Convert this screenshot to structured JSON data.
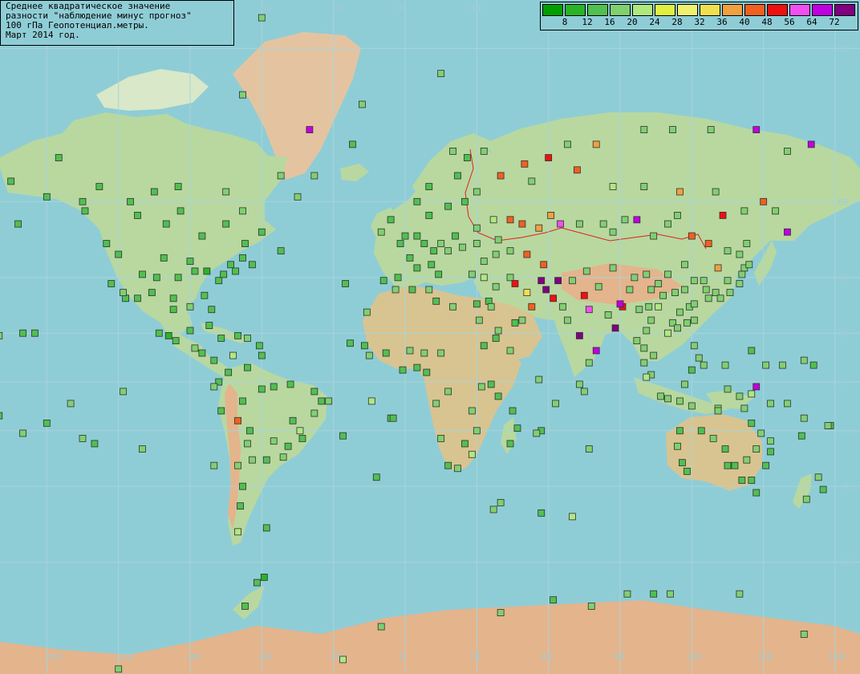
{
  "title_lines": [
    "Среднее квадратическое значение",
    "разности \"наблюдение минус прогноз\"",
    "100 гПа Геопотенциал.метры.",
    "Март 2014 год."
  ],
  "legend": {
    "thresholds": [
      "8",
      "12",
      "16",
      "20",
      "24",
      "28",
      "32",
      "36",
      "40",
      "48",
      "56",
      "64",
      "72"
    ],
    "colors": [
      "#00a000",
      "#28b428",
      "#50c050",
      "#80d070",
      "#b0e880",
      "#e0f040",
      "#f0f070",
      "#f0e050",
      "#f0a040",
      "#f06020",
      "#f01010",
      "#f050f0",
      "#c000e0",
      "#800080"
    ]
  },
  "grid": {
    "lon_labels": [
      "-150",
      "-120",
      "-90",
      "-60",
      "-30",
      "0",
      "30",
      "60",
      "90",
      "120",
      "150",
      "180"
    ],
    "lat_labels": [
      "80",
      "60",
      "40",
      "20",
      "0",
      "-20",
      "-40",
      "-60"
    ]
  },
  "colors": {
    "ocean": "#8fcdd6",
    "land": "#b8d8a0",
    "ice": "#eaf6f8",
    "highland": "#e4b48c",
    "border": "#e02020",
    "gridline": "#a8d4dc"
  },
  "stations": [
    [
      -175,
      70,
      3
    ],
    [
      -165,
      64,
      2
    ],
    [
      -162,
      55,
      2
    ],
    [
      -150,
      61,
      2
    ],
    [
      -145,
      68,
      2
    ],
    [
      -134,
      58,
      2
    ],
    [
      -125,
      50,
      2
    ],
    [
      -120,
      47,
      2
    ],
    [
      -123,
      38,
      2
    ],
    [
      -117,
      33,
      2
    ],
    [
      -118,
      35,
      3
    ],
    [
      -112,
      33,
      2
    ],
    [
      -106,
      35,
      2
    ],
    [
      -110,
      41,
      2
    ],
    [
      -104,
      40,
      2
    ],
    [
      -101,
      46,
      2
    ],
    [
      -97,
      33,
      2
    ],
    [
      -97,
      29,
      2
    ],
    [
      -95,
      40,
      2
    ],
    [
      -90,
      45,
      2
    ],
    [
      -90,
      30,
      3
    ],
    [
      -88,
      42,
      2
    ],
    [
      -84,
      34,
      2
    ],
    [
      -83,
      42,
      1
    ],
    [
      -81,
      29,
      2
    ],
    [
      -78,
      39,
      2
    ],
    [
      -76,
      41,
      2
    ],
    [
      -73,
      44,
      2
    ],
    [
      -71,
      42,
      2
    ],
    [
      -68,
      46,
      2
    ],
    [
      -64,
      44,
      2
    ],
    [
      -112,
      57,
      2
    ],
    [
      -100,
      55,
      2
    ],
    [
      -94,
      58,
      2
    ],
    [
      -85,
      52,
      2
    ],
    [
      -75,
      55,
      2
    ],
    [
      -67,
      50,
      2
    ],
    [
      -75,
      62,
      3
    ],
    [
      -68,
      58,
      3
    ],
    [
      -95,
      63,
      2
    ],
    [
      -105,
      62,
      2
    ],
    [
      -115,
      60,
      2
    ],
    [
      -128,
      63,
      2
    ],
    [
      -135,
      60,
      2
    ],
    [
      -60,
      53,
      2
    ],
    [
      -52,
      48,
      2
    ],
    [
      -52,
      65,
      3
    ],
    [
      -68,
      76,
      3
    ],
    [
      -45,
      61,
      3
    ],
    [
      -38,
      65,
      3
    ],
    [
      -22,
      70,
      2
    ],
    [
      -18,
      75,
      3
    ],
    [
      -40,
      72,
      12
    ],
    [
      -60,
      82,
      3
    ],
    [
      -103,
      20,
      2
    ],
    [
      -99,
      19,
      1
    ],
    [
      -96,
      17,
      2
    ],
    [
      -90,
      21,
      2
    ],
    [
      -88,
      14,
      3
    ],
    [
      -85,
      12,
      2
    ],
    [
      -80,
      9,
      2
    ],
    [
      -82,
      23,
      2
    ],
    [
      -77,
      18,
      2
    ],
    [
      -70,
      19,
      2
    ],
    [
      -66,
      18,
      3
    ],
    [
      -61,
      15,
      2
    ],
    [
      -60,
      11,
      2
    ],
    [
      -72,
      11,
      4
    ],
    [
      -66,
      6,
      2
    ],
    [
      -74,
      4,
      2
    ],
    [
      -78,
      0,
      2
    ],
    [
      -80,
      -2,
      3
    ],
    [
      -77,
      -12,
      2
    ],
    [
      -70,
      -16,
      9
    ],
    [
      -68,
      -8,
      2
    ],
    [
      -60,
      -3,
      2
    ],
    [
      -55,
      -2,
      2
    ],
    [
      -48,
      -1,
      2
    ],
    [
      -38,
      -4,
      2
    ],
    [
      -35,
      -8,
      2
    ],
    [
      -38,
      -13,
      3
    ],
    [
      -47,
      -16,
      2
    ],
    [
      -43,
      -23,
      2
    ],
    [
      -49,
      -26,
      2
    ],
    [
      -55,
      -24,
      3
    ],
    [
      -58,
      -31,
      2
    ],
    [
      -64,
      -31,
      3
    ],
    [
      -66,
      -25,
      3
    ],
    [
      -70,
      -33,
      3
    ],
    [
      -68,
      -40,
      2
    ],
    [
      -69,
      -46,
      2
    ],
    [
      -70,
      -53,
      4
    ],
    [
      -58,
      -52,
      2
    ],
    [
      -59,
      -63,
      1
    ],
    [
      -65,
      -20,
      2
    ],
    [
      -51,
      -30,
      3
    ],
    [
      -44,
      -20,
      4
    ],
    [
      -25,
      38,
      2
    ],
    [
      -16,
      28,
      3
    ],
    [
      -17,
      15,
      2
    ],
    [
      -23,
      16,
      2
    ],
    [
      -14,
      -8,
      4
    ],
    [
      -6,
      -15,
      2
    ],
    [
      -12,
      -37,
      2
    ],
    [
      -26,
      -22,
      2
    ],
    [
      -10,
      53,
      3
    ],
    [
      -2,
      50,
      2
    ],
    [
      -6,
      56,
      2
    ],
    [
      0,
      52,
      2
    ],
    [
      5,
      52,
      2
    ],
    [
      8,
      50,
      2
    ],
    [
      2,
      46,
      2
    ],
    [
      5,
      43,
      2
    ],
    [
      12,
      48,
      2
    ],
    [
      11,
      44,
      2
    ],
    [
      15,
      50,
      3
    ],
    [
      14,
      41,
      2
    ],
    [
      18,
      48,
      3
    ],
    [
      21,
      52,
      2
    ],
    [
      24,
      49,
      3
    ],
    [
      10,
      57,
      2
    ],
    [
      18,
      59,
      2
    ],
    [
      25,
      60,
      2
    ],
    [
      30,
      62,
      3
    ],
    [
      22,
      65,
      2
    ],
    [
      26,
      68,
      2
    ],
    [
      10,
      63,
      2
    ],
    [
      5,
      60,
      2
    ],
    [
      15,
      78,
      3
    ],
    [
      -3,
      40,
      2
    ],
    [
      -9,
      39,
      2
    ],
    [
      -4,
      36,
      3
    ],
    [
      3,
      36,
      2
    ],
    [
      10,
      36,
      3
    ],
    [
      13,
      32,
      2
    ],
    [
      20,
      30,
      3
    ],
    [
      30,
      31,
      2
    ],
    [
      31,
      25,
      3
    ],
    [
      33,
      15,
      2
    ],
    [
      38,
      18,
      2
    ],
    [
      32,
      -2,
      3
    ],
    [
      36,
      -1,
      2
    ],
    [
      39,
      -6,
      2
    ],
    [
      28,
      -12,
      3
    ],
    [
      30,
      -20,
      3
    ],
    [
      25,
      -25,
      2
    ],
    [
      28,
      -29,
      4
    ],
    [
      18,
      -33,
      2
    ],
    [
      22,
      -34,
      3
    ],
    [
      15,
      -23,
      3
    ],
    [
      13,
      -9,
      3
    ],
    [
      9,
      4,
      2
    ],
    [
      5,
      6,
      2
    ],
    [
      -1,
      5,
      2
    ],
    [
      -15,
      11,
      3
    ],
    [
      -8,
      12,
      2
    ],
    [
      2,
      13,
      3
    ],
    [
      8,
      12,
      3
    ],
    [
      15,
      12,
      3
    ],
    [
      18,
      -4,
      3
    ],
    [
      45,
      -12,
      2
    ],
    [
      47,
      -19,
      2
    ],
    [
      57,
      -20,
      2
    ],
    [
      55,
      -21,
      3
    ],
    [
      44,
      -25,
      2
    ],
    [
      28,
      41,
      3
    ],
    [
      33,
      40,
      4
    ],
    [
      38,
      37,
      3
    ],
    [
      44,
      40,
      3
    ],
    [
      35,
      32,
      2
    ],
    [
      36,
      30,
      3
    ],
    [
      39,
      21,
      3
    ],
    [
      46,
      24,
      2
    ],
    [
      44,
      13,
      3
    ],
    [
      49,
      25,
      3
    ],
    [
      53,
      30,
      9
    ],
    [
      51,
      35,
      7
    ],
    [
      59,
      36,
      13
    ],
    [
      46,
      38,
      10
    ],
    [
      57,
      39,
      13
    ],
    [
      62,
      33,
      10
    ],
    [
      66,
      30,
      3
    ],
    [
      68,
      25,
      3
    ],
    [
      73,
      19,
      13
    ],
    [
      77,
      29,
      11
    ],
    [
      80,
      13,
      12
    ],
    [
      77,
      8,
      3
    ],
    [
      88,
      22,
      13
    ],
    [
      85,
      27,
      3
    ],
    [
      91,
      30,
      10
    ],
    [
      75,
      34,
      10
    ],
    [
      81,
      37,
      3
    ],
    [
      87,
      43,
      3
    ],
    [
      76,
      42,
      3
    ],
    [
      70,
      39,
      3
    ],
    [
      64,
      39,
      13
    ],
    [
      58,
      44,
      9
    ],
    [
      51,
      47,
      9
    ],
    [
      44,
      48,
      3
    ],
    [
      38,
      47,
      3
    ],
    [
      33,
      45,
      3
    ],
    [
      39,
      51,
      3
    ],
    [
      30,
      50,
      3
    ],
    [
      37,
      56,
      4
    ],
    [
      30,
      54,
      3
    ],
    [
      44,
      56,
      9
    ],
    [
      49,
      55,
      9
    ],
    [
      56,
      54,
      8
    ],
    [
      61,
      57,
      8
    ],
    [
      65,
      55,
      11
    ],
    [
      73,
      55,
      3
    ],
    [
      83,
      55,
      3
    ],
    [
      87,
      53,
      3
    ],
    [
      92,
      56,
      3
    ],
    [
      97,
      56,
      12
    ],
    [
      104,
      52,
      3
    ],
    [
      110,
      55,
      3
    ],
    [
      114,
      57,
      3
    ],
    [
      120,
      52,
      9
    ],
    [
      127,
      50,
      9
    ],
    [
      131,
      43,
      8
    ],
    [
      135,
      48,
      3
    ],
    [
      140,
      47,
      3
    ],
    [
      143,
      50,
      3
    ],
    [
      130,
      62,
      3
    ],
    [
      115,
      62,
      8
    ],
    [
      100,
      63,
      3
    ],
    [
      87,
      63,
      4
    ],
    [
      72,
      66,
      9
    ],
    [
      60,
      68,
      10
    ],
    [
      50,
      67,
      9
    ],
    [
      40,
      65,
      9
    ],
    [
      33,
      69,
      3
    ],
    [
      20,
      69,
      3
    ],
    [
      53,
      64,
      3
    ],
    [
      68,
      70,
      3
    ],
    [
      80,
      70,
      8
    ],
    [
      100,
      72,
      3
    ],
    [
      112,
      72,
      3
    ],
    [
      128,
      72,
      3
    ],
    [
      147,
      72,
      12
    ],
    [
      160,
      69,
      3
    ],
    [
      170,
      70,
      12
    ],
    [
      150,
      60,
      9
    ],
    [
      160,
      53,
      12
    ],
    [
      155,
      58,
      3
    ],
    [
      142,
      58,
      3
    ],
    [
      133,
      57,
      10
    ],
    [
      117,
      44,
      3
    ],
    [
      110,
      41,
      3
    ],
    [
      106,
      38,
      3
    ],
    [
      103,
      36,
      3
    ],
    [
      101,
      41,
      3
    ],
    [
      96,
      40,
      3
    ],
    [
      94,
      36,
      3
    ],
    [
      90,
      31,
      12
    ],
    [
      98,
      29,
      3
    ],
    [
      102,
      30,
      3
    ],
    [
      106,
      30,
      4
    ],
    [
      108,
      34,
      3
    ],
    [
      113,
      35,
      3
    ],
    [
      117,
      36,
      3
    ],
    [
      121,
      39,
      3
    ],
    [
      125,
      39,
      3
    ],
    [
      126,
      36,
      3
    ],
    [
      127,
      33,
      3
    ],
    [
      130,
      35,
      3
    ],
    [
      132,
      33,
      3
    ],
    [
      136,
      35,
      3
    ],
    [
      140,
      38,
      3
    ],
    [
      141,
      41,
      3
    ],
    [
      142,
      43,
      3
    ],
    [
      144,
      44,
      3
    ],
    [
      135,
      39,
      3
    ],
    [
      119,
      30,
      3
    ],
    [
      115,
      28,
      3
    ],
    [
      112,
      24,
      3
    ],
    [
      110,
      20,
      4
    ],
    [
      114,
      22,
      3
    ],
    [
      118,
      24,
      3
    ],
    [
      121,
      25,
      3
    ],
    [
      121,
      31,
      3
    ],
    [
      103,
      25,
      3
    ],
    [
      101,
      21,
      3
    ],
    [
      97,
      17,
      3
    ],
    [
      100,
      14,
      3
    ],
    [
      104,
      11,
      3
    ],
    [
      100,
      8,
      3
    ],
    [
      103,
      3,
      3
    ],
    [
      101,
      2,
      4
    ],
    [
      107,
      -6,
      3
    ],
    [
      110,
      -7,
      3
    ],
    [
      115,
      -8,
      3
    ],
    [
      117,
      -1,
      3
    ],
    [
      120,
      5,
      2
    ],
    [
      123,
      10,
      3
    ],
    [
      121,
      15,
      3
    ],
    [
      125,
      7,
      3
    ],
    [
      135,
      -3,
      3
    ],
    [
      140,
      -6,
      3
    ],
    [
      131,
      -11,
      3
    ],
    [
      145,
      -5,
      4
    ],
    [
      153,
      -9,
      3
    ],
    [
      160,
      -9,
      3
    ],
    [
      167,
      -15,
      3
    ],
    [
      178,
      -18,
      2
    ],
    [
      166,
      -22,
      2
    ],
    [
      147,
      -2,
      12
    ],
    [
      120,
      -10,
      3
    ],
    [
      115,
      -20,
      2
    ],
    [
      114,
      -26,
      3
    ],
    [
      116,
      -32,
      2
    ],
    [
      118,
      -35,
      2
    ],
    [
      124,
      -20,
      2
    ],
    [
      129,
      -23,
      3
    ],
    [
      134,
      -27,
      2
    ],
    [
      138,
      -33,
      2
    ],
    [
      141,
      -38,
      2
    ],
    [
      145,
      -38,
      2
    ],
    [
      147,
      -42,
      2
    ],
    [
      151,
      -33,
      2
    ],
    [
      153,
      -28,
      2
    ],
    [
      147,
      -27,
      3
    ],
    [
      143,
      -31,
      3
    ],
    [
      135,
      -33,
      2
    ],
    [
      131,
      -12,
      3
    ],
    [
      142,
      -11,
      3
    ],
    [
      145,
      -17,
      2
    ],
    [
      149,
      -21,
      3
    ],
    [
      153,
      -24,
      3
    ],
    [
      173,
      -37,
      3
    ],
    [
      175,
      -41,
      2
    ],
    [
      168,
      -44,
      3
    ],
    [
      177,
      -18,
      3
    ],
    [
      -178,
      -14,
      2
    ],
    [
      -170,
      -14,
      2
    ],
    [
      -160,
      -21,
      3
    ],
    [
      -150,
      -17,
      2
    ],
    [
      -140,
      -9,
      3
    ],
    [
      -135,
      -23,
      3
    ],
    [
      -130,
      -25,
      2
    ],
    [
      -160,
      20,
      2
    ],
    [
      -155,
      20,
      2
    ],
    [
      -170,
      19,
      3
    ],
    [
      -177,
      28,
      2
    ],
    [
      -118,
      -4,
      3
    ],
    [
      -110,
      -27,
      3
    ],
    [
      -80,
      -33,
      3
    ],
    [
      -32,
      -8,
      3
    ],
    [
      -5,
      -15,
      2
    ],
    [
      167,
      9,
      3
    ],
    [
      171,
      7,
      2
    ],
    [
      158,
      7,
      3
    ],
    [
      145,
      13,
      2
    ],
    [
      151,
      7,
      3
    ],
    [
      134,
      7,
      3
    ],
    [
      56,
      1,
      3
    ],
    [
      73,
      -1,
      3
    ],
    [
      75,
      -4,
      3
    ],
    [
      77,
      -27,
      3
    ],
    [
      63,
      -9,
      3
    ],
    [
      57,
      -48,
      2
    ],
    [
      70,
      -49,
      4
    ],
    [
      40,
      -45,
      3
    ],
    [
      37,
      -47,
      3
    ],
    [
      104,
      -66,
      2
    ],
    [
      111,
      -66,
      3
    ],
    [
      93,
      -66,
      3
    ],
    [
      78,
      -68,
      3
    ],
    [
      62,
      -67,
      2
    ],
    [
      40,
      -69,
      3
    ],
    [
      166,
      -77,
      3
    ],
    [
      -67,
      -68,
      2
    ],
    [
      -62,
      -64,
      2
    ],
    [
      -26,
      -75,
      4
    ],
    [
      -10,
      -71,
      3
    ],
    [
      140,
      -66,
      3
    ],
    [
      167,
      -72,
      3
    ],
    [
      -120,
      -76,
      3
    ]
  ]
}
